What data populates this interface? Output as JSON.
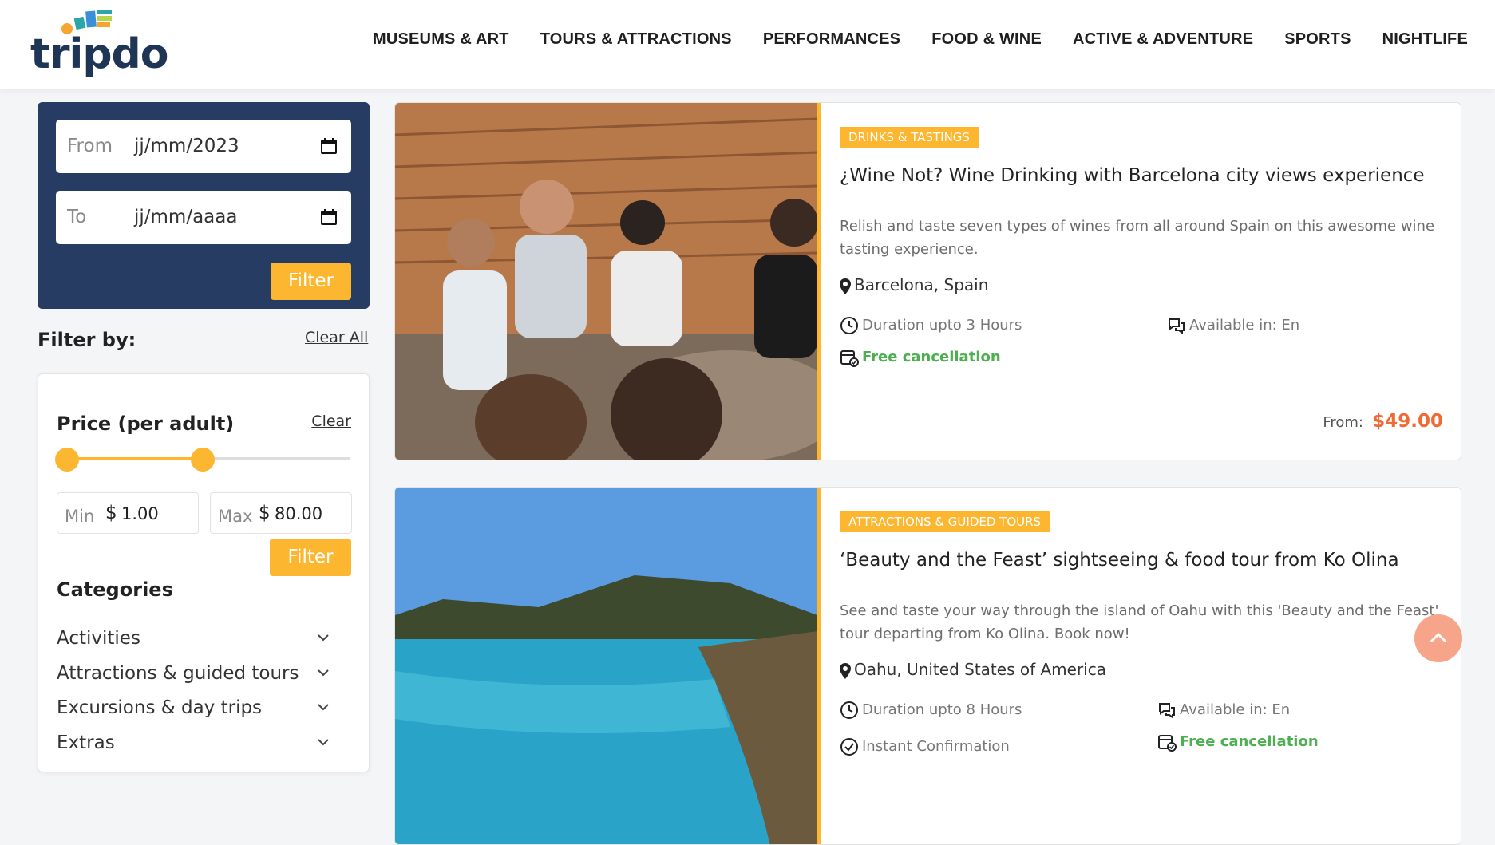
{
  "brand": {
    "logo_text": "tripdo"
  },
  "nav": {
    "items": [
      {
        "label": "MUSEUMS & ART"
      },
      {
        "label": "TOURS & ATTRACTIONS"
      },
      {
        "label": "PERFORMANCES"
      },
      {
        "label": "FOOD & WINE"
      },
      {
        "label": "ACTIVE & ADVENTURE"
      },
      {
        "label": "SPORTS"
      },
      {
        "label": "NIGHTLIFE"
      }
    ]
  },
  "date_filter": {
    "from_label": "From",
    "from_value": "jj/mm/2023",
    "to_label": "To",
    "to_value": "jj/mm/aaaa",
    "filter_label": "Filter"
  },
  "filters": {
    "title": "Filter by:",
    "clear_all": "Clear All",
    "price": {
      "title": "Price (per adult)",
      "clear": "Clear",
      "min_label": "Min",
      "min_currency": "$",
      "min_value": "1.00",
      "max_label": "Max",
      "max_currency": "$",
      "max_value": "80.00",
      "filter_label": "Filter",
      "slider_min_fraction": 0,
      "slider_max_fraction": 0.48
    },
    "categories": {
      "title": "Categories",
      "items": [
        {
          "label": "Activities"
        },
        {
          "label": "Attractions & guided tours"
        },
        {
          "label": "Excursions & day trips"
        },
        {
          "label": "Extras"
        }
      ]
    }
  },
  "cards": [
    {
      "badge": "DRINKS & TASTINGS",
      "title": "¿Wine Not? Wine Drinking with Barcelona city views experience",
      "description": "Relish and taste seven types of wines from all around Spain on this awesome wine tasting experience.",
      "location": "Barcelona, Spain",
      "duration": "Duration upto 3 Hours",
      "available": "Available in: En",
      "cancellation": "Free cancellation",
      "from_label": "From:",
      "price": "$49.00"
    },
    {
      "badge": "ATTRACTIONS & GUIDED TOURS",
      "title": "‘Beauty and the Feast’ sightseeing & food tour from Ko Olina",
      "description": "See and taste your way through the island of Oahu with this 'Beauty and the Feast' tour departing from Ko Olina. Book now!",
      "location": "Oahu, United States of America",
      "duration": "Duration upto 8 Hours",
      "available": "Available in: En",
      "confirmation": "Instant Confirmation",
      "cancellation": "Free cancellation"
    }
  ],
  "colors": {
    "accent": "#fcb62f",
    "navy": "#273c63",
    "price": "#f06a35",
    "green": "#4caf50",
    "scroll_btn": "#f6a58a"
  }
}
